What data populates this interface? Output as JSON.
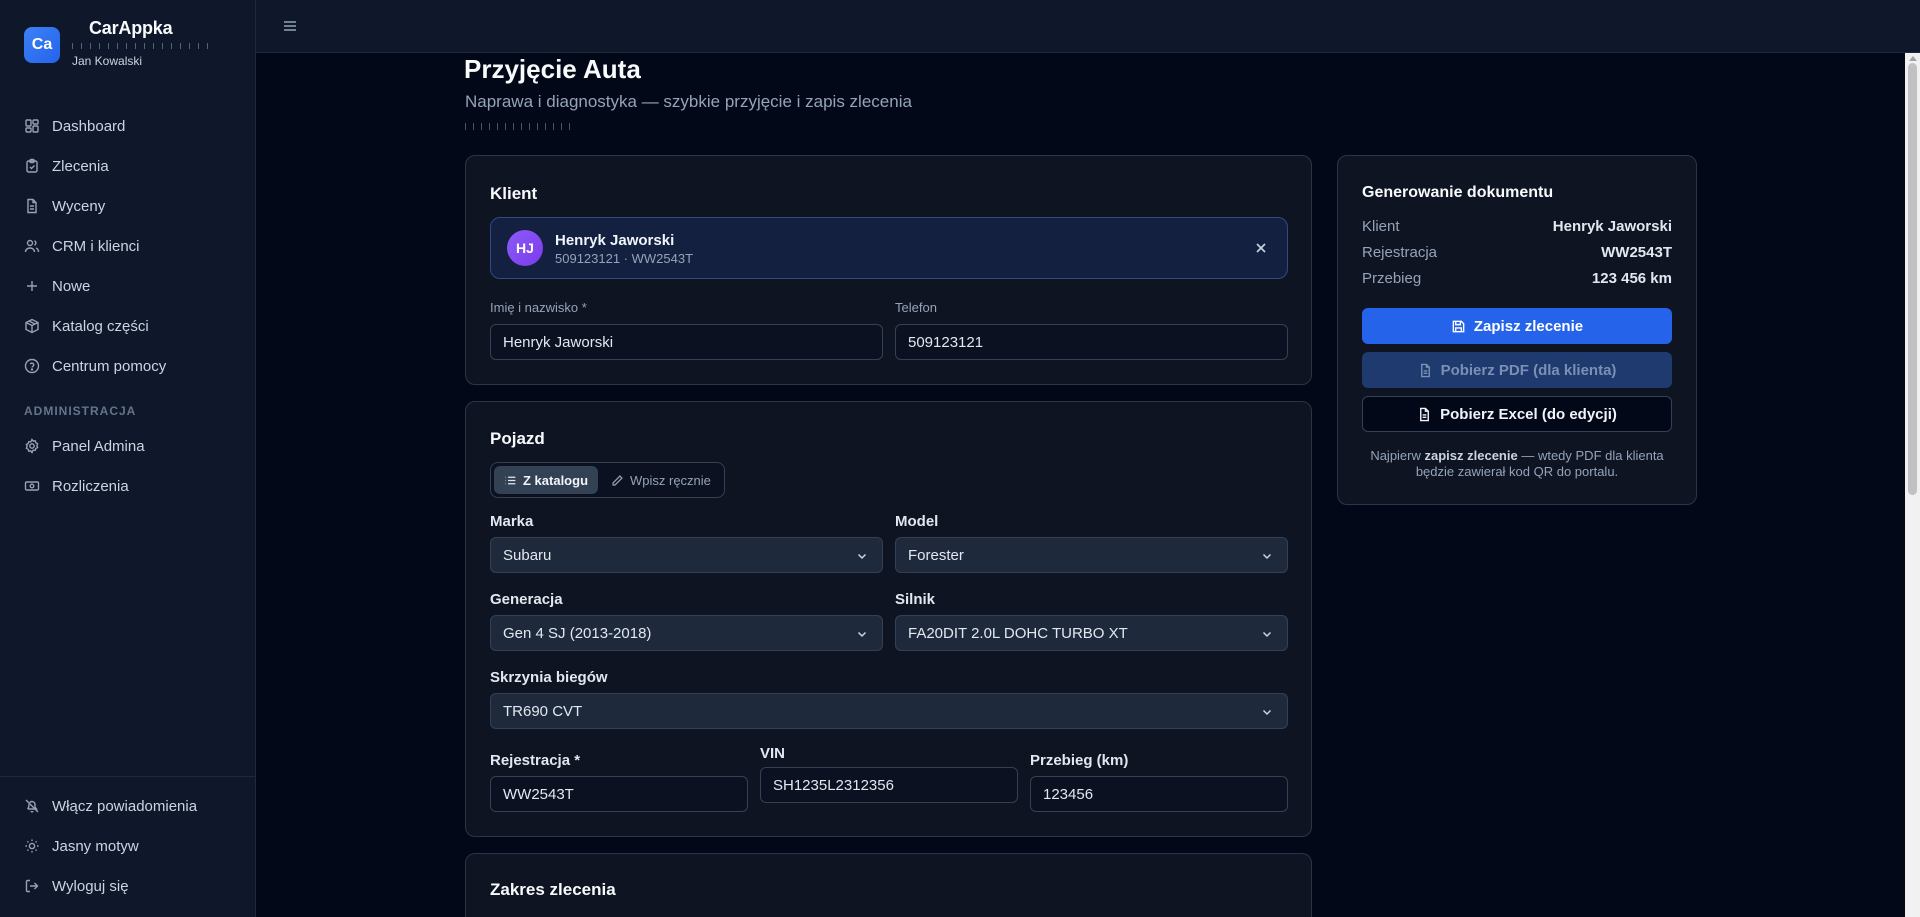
{
  "brand": {
    "logo_text": "Ca",
    "app_name": "CarAppka",
    "user_name": "Jan Kowalski"
  },
  "nav": {
    "items": [
      {
        "label": "Dashboard"
      },
      {
        "label": "Zlecenia"
      },
      {
        "label": "Wyceny"
      },
      {
        "label": "CRM i klienci"
      },
      {
        "label": "Nowe"
      },
      {
        "label": "Katalog części"
      },
      {
        "label": "Centrum pomocy"
      }
    ],
    "admin_section": "ADMINISTRACJA",
    "admin_items": [
      {
        "label": "Panel Admina"
      },
      {
        "label": "Rozliczenia"
      }
    ],
    "bottom_items": [
      {
        "label": "Włącz powiadomienia"
      },
      {
        "label": "Jasny motyw"
      },
      {
        "label": "Wyloguj się"
      }
    ]
  },
  "page": {
    "title": "Przyjęcie Auta",
    "subtitle": "Naprawa i diagnostyka — szybkie przyjęcie i zapis zlecenia"
  },
  "client": {
    "section_title": "Klient",
    "chip": {
      "initials": "HJ",
      "name": "Henryk Jaworski",
      "details": "509123121 · WW2543T"
    },
    "name_label": "Imię i nazwisko *",
    "name_value": "Henryk Jaworski",
    "phone_label": "Telefon",
    "phone_value": "509123121"
  },
  "vehicle": {
    "section_title": "Pojazd",
    "mode_catalog": "Z katalogu",
    "mode_manual": "Wpisz ręcznie",
    "brand_label": "Marka",
    "brand_value": "Subaru",
    "model_label": "Model",
    "model_value": "Forester",
    "generation_label": "Generacja",
    "generation_value": "Gen 4 SJ (2013-2018)",
    "engine_label": "Silnik",
    "engine_value": "FA20DIT 2.0L DOHC TURBO XT",
    "gearbox_label": "Skrzynia biegów",
    "gearbox_value": "TR690 CVT",
    "registration_label": "Rejestracja *",
    "registration_value": "WW2543T",
    "vin_label": "VIN",
    "vin_value": "SH1235L2312356",
    "mileage_label": "Przebieg (km)",
    "mileage_value": "123456"
  },
  "scope": {
    "section_title": "Zakres zlecenia"
  },
  "document": {
    "title": "Generowanie dokumentu",
    "rows": [
      {
        "key": "Klient",
        "value": "Henryk Jaworski"
      },
      {
        "key": "Rejestracja",
        "value": "WW2543T"
      },
      {
        "key": "Przebieg",
        "value": "123 456 km"
      }
    ],
    "save_button": "Zapisz zlecenie",
    "pdf_button": "Pobierz PDF (dla klienta)",
    "excel_button": "Pobierz Excel (do edycji)",
    "note_prefix": "Najpierw ",
    "note_bold": "zapisz zlecenie",
    "note_suffix": " — wtedy PDF dla klienta będzie zawierał kod QR do portalu."
  },
  "colors": {
    "accent": "#2563eb",
    "background": "#020817",
    "sidebar": "#0f172a",
    "avatar": "#8b5cf6"
  }
}
